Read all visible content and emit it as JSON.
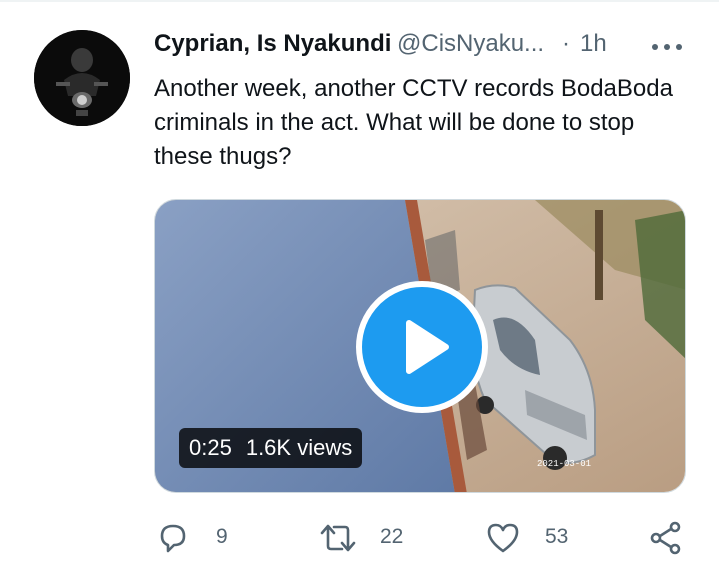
{
  "tweet": {
    "author_name": "Cyprian, Is Nyakundi",
    "author_handle": "@CisNyaku...",
    "dot": "·",
    "time": "1h",
    "text": "Another week, another CCTV records BodaBoda criminals in the act. What will be done to stop these thugs?",
    "avatar_icon": "motorcycle-rider-photo"
  },
  "video": {
    "duration": "0:25",
    "views": "1.6K views",
    "thumbnail_stamp": "2021-03-01",
    "play_color": "#1d9bf0"
  },
  "actions": {
    "reply_count": "9",
    "retweet_count": "22",
    "like_count": "53",
    "reply_icon": "reply-icon",
    "retweet_icon": "retweet-icon",
    "like_icon": "heart-icon",
    "share_icon": "share-icon"
  }
}
